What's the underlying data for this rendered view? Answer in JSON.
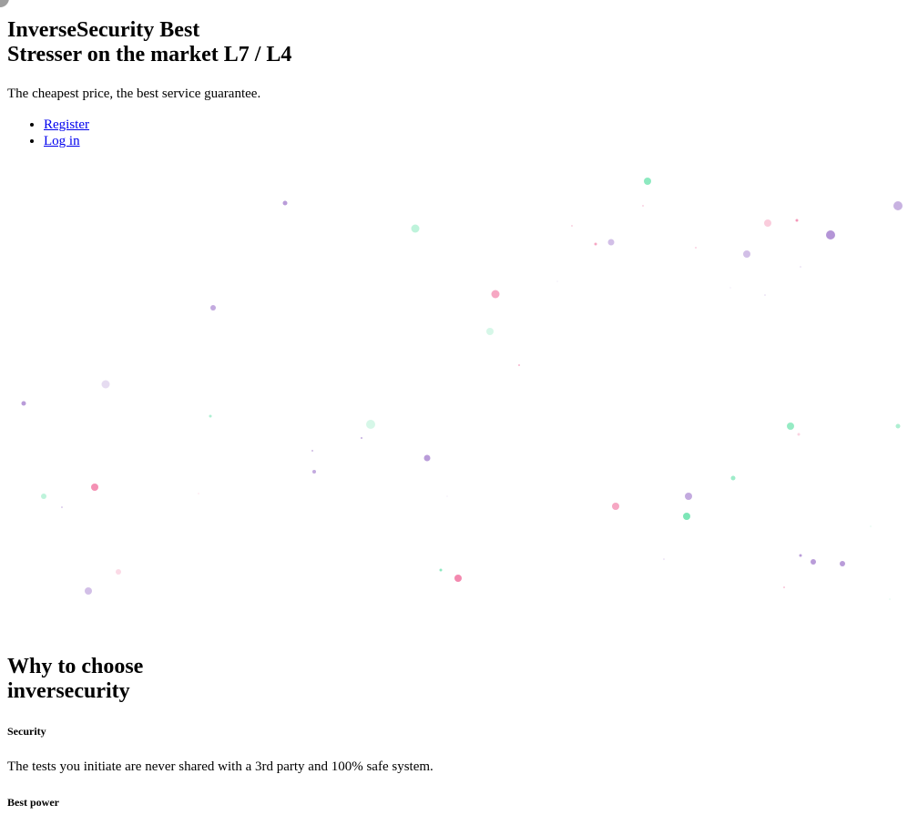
{
  "hero": {
    "title_line1": "InverseSecurity Best",
    "title_line2": "Stresser on the market L7 / L4",
    "tagline": "The cheapest price, the best service guarantee."
  },
  "nav": {
    "items": [
      {
        "label": "Register"
      },
      {
        "label": "Log in"
      }
    ]
  },
  "why": {
    "title_line1": "Why to choose",
    "title_line2": "inversecurity",
    "features": [
      {
        "heading": "Security",
        "text": "The tests you initiate are never shared with a 3rd party and 100% safe system."
      },
      {
        "heading": "Best power",
        "text": ""
      }
    ]
  },
  "colors": {
    "link": "#0000ee",
    "particle_green": "#5de0a5",
    "particle_pink": "#f06c9b",
    "particle_purple": "#9b72c9",
    "corner_dot": "#9e9e9e"
  }
}
